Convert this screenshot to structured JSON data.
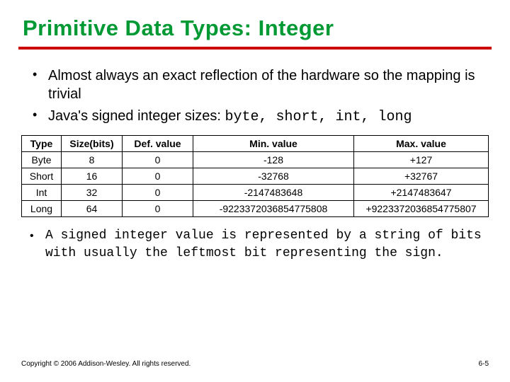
{
  "title": "Primitive Data Types: Integer",
  "bullets": {
    "b1": "Almost always an exact reflection of the hardware so the mapping is trivial",
    "b2_prefix": "Java's signed integer sizes: ",
    "b2_code": "byte, short, int, long"
  },
  "table": {
    "headers": {
      "type": "Type",
      "size": "Size(bits)",
      "def": "Def. value",
      "min": "Min. value",
      "max": "Max. value"
    },
    "rows": [
      {
        "type": "Byte",
        "size": "8",
        "def": "0",
        "min": "-128",
        "max": "+127"
      },
      {
        "type": "Short",
        "size": "16",
        "def": "0",
        "min": "-32768",
        "max": "+32767"
      },
      {
        "type": "Int",
        "size": "32",
        "def": "0",
        "min": "-2147483648",
        "max": "+2147483647"
      },
      {
        "type": "Long",
        "size": "64",
        "def": "0",
        "min": "-9223372036854775808",
        "max": "+9223372036854775807"
      }
    ]
  },
  "note": "A signed integer value is represented by a string of bits with usually the leftmost bit representing the sign.",
  "footer": {
    "copyright": "Copyright © 2006 Addison-Wesley. All rights reserved.",
    "page": "6-5"
  }
}
